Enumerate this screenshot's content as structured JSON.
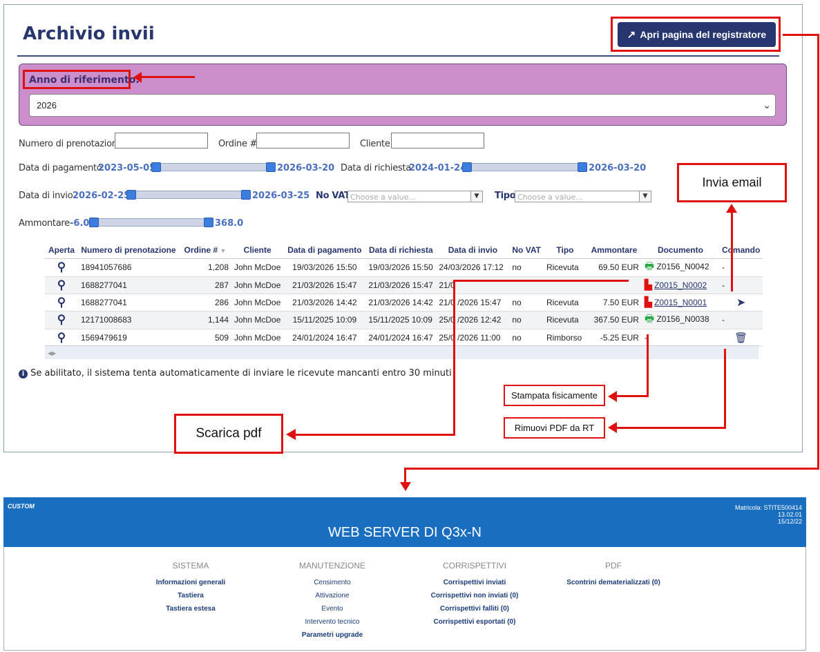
{
  "header": {
    "title": "Archivio invii",
    "register_button": "Apri pagina del registratore"
  },
  "year": {
    "label": "Anno di riferimento:",
    "value": "2026"
  },
  "filters": {
    "booking_label": "Numero di prenotazione",
    "order_label": "Ordine #",
    "customer_label": "Cliente",
    "payment_label": "Data di pagamento",
    "payment_min": "2023-05-05",
    "payment_max": "2026-03-20",
    "request_label": "Data di richiesta",
    "request_min": "2024-01-24",
    "request_max": "2026-03-20",
    "send_label": "Data di invio",
    "send_min": "2026-02-25",
    "send_max": "2026-03-25",
    "novat_label": "No VAT",
    "novat_placeholder": "Choose a value...",
    "tipo_label": "Tipo",
    "tipo_placeholder": "Choose a value...",
    "amount_label": "Ammontare",
    "amount_min": "-6.0",
    "amount_max": "368.0"
  },
  "table": {
    "columns": [
      "Aperta",
      "Numero di prenotazione",
      "Ordine #",
      "Cliente",
      "Data di pagamento",
      "Data di richiesta",
      "Data di invio",
      "No VAT",
      "Tipo",
      "Ammontare",
      "Documento",
      "Comando"
    ],
    "rows": [
      {
        "booking": "18941057686",
        "order": "1,208",
        "customer": "John McDoe",
        "paid": "19/03/2026 15:50",
        "requested": "19/03/2026 15:50",
        "sent": "24/03/2026 17:12",
        "novat": "no",
        "type": "Ricevuta",
        "amount": "69.50 EUR",
        "doc": "Z0156_N0042",
        "doc_icon": "printer-icon",
        "command": "-"
      },
      {
        "booking": "1688277041",
        "order": "287",
        "customer": "John McDoe",
        "paid": "21/03/2026 15:47",
        "requested": "21/03/2026 15:47",
        "sent": "21/0",
        "novat": "",
        "type": "",
        "amount": "",
        "doc": "Z0015_N0002",
        "doc_icon": "pdf-icon",
        "command": "-"
      },
      {
        "booking": "1688277041",
        "order": "286",
        "customer": "John McDoe",
        "paid": "21/03/2026 14:42",
        "requested": "21/03/2026 14:42",
        "sent": "21/0 /2026 15:47",
        "novat": "no",
        "type": "Ricevuta",
        "amount": "7.50 EUR",
        "doc": "Z0015_N0001",
        "doc_icon": "pdf-icon",
        "command": ""
      },
      {
        "booking": "12171008683",
        "order": "1,144",
        "customer": "John McDoe",
        "paid": "15/11/2025 10:09",
        "requested": "15/11/2025 10:09",
        "sent": "25/0 /2026 12:42",
        "novat": "no",
        "type": "Ricevuta",
        "amount": "367.50 EUR",
        "doc": "Z0156_N0038",
        "doc_icon": "printer-icon",
        "command": "-"
      },
      {
        "booking": "1569479619",
        "order": "509",
        "customer": "John McDoe",
        "paid": "24/01/2024 16:47",
        "requested": "24/01/2024 16:47",
        "sent": "25/0 /2026 11:00",
        "novat": "no",
        "type": "Rimborso",
        "amount": "-5.25 EUR",
        "doc": "-",
        "doc_icon": "",
        "command": ""
      }
    ]
  },
  "info_note": "Se abilitato, il sistema tenta automaticamente di inviare le ricevute mancanti entro 30 minuti",
  "callouts": {
    "email": "Invia email",
    "printed": "Stampata fisicamente",
    "remove_pdf": "Rimuovi PDF da RT",
    "download_pdf": "Scarica pdf"
  },
  "webserver": {
    "logo": "CUSTOM",
    "title": "WEB SERVER DI Q3x-N",
    "serial": "Matricola: STITE500414",
    "version": "13.02.01",
    "date": "15/12/22",
    "sections": [
      {
        "title": "SISTEMA",
        "items": [
          "Informazioni generali",
          "Tastiera",
          "Tastiera estesa"
        ]
      },
      {
        "title": "MANUTENZIONE",
        "items": [
          "Censimento",
          "Attivazione",
          "Evento",
          "Intervento tecnico",
          "Parametri upgrade"
        ]
      },
      {
        "title": "CORRISPETTIVI",
        "items": [
          "Corrispettivi inviati",
          "Corrispettivi non inviati (0)",
          "Corrispettivi falliti (0)",
          "Corrispettivi esportati (0)"
        ]
      },
      {
        "title": "PDF",
        "items": [
          "Scontrini dematerializzati (0)"
        ]
      }
    ]
  }
}
